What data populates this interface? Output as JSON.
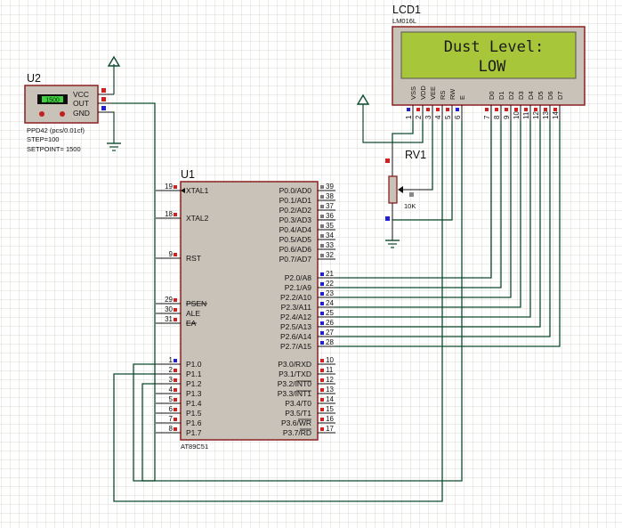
{
  "u2": {
    "ref": "U2",
    "display": "1500",
    "pins": [
      "VCC",
      "OUT",
      "GND"
    ],
    "props": [
      "PPD42 (pcs/0.01cf)",
      "STEP=100",
      "SETPOINT= 1500"
    ]
  },
  "lcd": {
    "ref": "LCD1",
    "model": "LM016L",
    "line1": "Dust Level:",
    "line2": "LOW",
    "pin_labels": [
      "VSS",
      "VDD",
      "VEE",
      "RS",
      "RW",
      "E",
      "D0",
      "D1",
      "D2",
      "D3",
      "D4",
      "D5",
      "D6",
      "D7"
    ],
    "pin_numbers": [
      "1",
      "2",
      "3",
      "4",
      "5",
      "6",
      "7",
      "8",
      "9",
      "10",
      "11",
      "12",
      "13",
      "14"
    ]
  },
  "rv1": {
    "ref": "RV1",
    "value": "10K"
  },
  "u1": {
    "ref": "U1",
    "part": "AT89C51",
    "left_pins": [
      {
        "num": "19",
        "label": "XTAL1"
      },
      {
        "num": "18",
        "label": "XTAL2"
      },
      {
        "num": "9",
        "label": "RST"
      },
      {
        "num": "29",
        "label": "PSEN"
      },
      {
        "num": "30",
        "label": "ALE"
      },
      {
        "num": "31",
        "label": "EA"
      },
      {
        "num": "1",
        "label": "P1.0"
      },
      {
        "num": "2",
        "label": "P1.1"
      },
      {
        "num": "3",
        "label": "P1.2"
      },
      {
        "num": "4",
        "label": "P1.3"
      },
      {
        "num": "5",
        "label": "P1.4"
      },
      {
        "num": "6",
        "label": "P1.5"
      },
      {
        "num": "7",
        "label": "P1.6"
      },
      {
        "num": "8",
        "label": "P1.7"
      }
    ],
    "right_pins": [
      {
        "num": "39",
        "label": "P0.0/AD0"
      },
      {
        "num": "38",
        "label": "P0.1/AD1"
      },
      {
        "num": "37",
        "label": "P0.2/AD2"
      },
      {
        "num": "36",
        "label": "P0.3/AD3"
      },
      {
        "num": "35",
        "label": "P0.4/AD4"
      },
      {
        "num": "34",
        "label": "P0.5/AD5"
      },
      {
        "num": "33",
        "label": "P0.6/AD6"
      },
      {
        "num": "32",
        "label": "P0.7/AD7"
      },
      {
        "num": "21",
        "label": "P2.0/A8"
      },
      {
        "num": "22",
        "label": "P2.1/A9"
      },
      {
        "num": "23",
        "label": "P2.2/A10"
      },
      {
        "num": "24",
        "label": "P2.3/A11"
      },
      {
        "num": "25",
        "label": "P2.4/A12"
      },
      {
        "num": "26",
        "label": "P2.5/A13"
      },
      {
        "num": "27",
        "label": "P2.6/A14"
      },
      {
        "num": "28",
        "label": "P2.7/A15"
      },
      {
        "num": "10",
        "label": "P3.0/RXD"
      },
      {
        "num": "11",
        "label": "P3.1/TXD"
      },
      {
        "num": "12",
        "label": "P3.2/INT0"
      },
      {
        "num": "13",
        "label": "P3.3/INT1"
      },
      {
        "num": "14",
        "label": "P3.4/T0"
      },
      {
        "num": "15",
        "label": "P3.5/T1"
      },
      {
        "num": "16",
        "label": "P3.6/WR"
      },
      {
        "num": "17",
        "label": "P3.7/RD"
      }
    ]
  },
  "colors": {
    "grid": "#d9d9d2",
    "wire": "#0f4a2e",
    "chip_fill": "#c9c2b8",
    "chip_border": "#8a2020",
    "lcd_screen": "#a8c63a",
    "pin_red": "#d02020",
    "pin_blue": "#2020d0"
  }
}
